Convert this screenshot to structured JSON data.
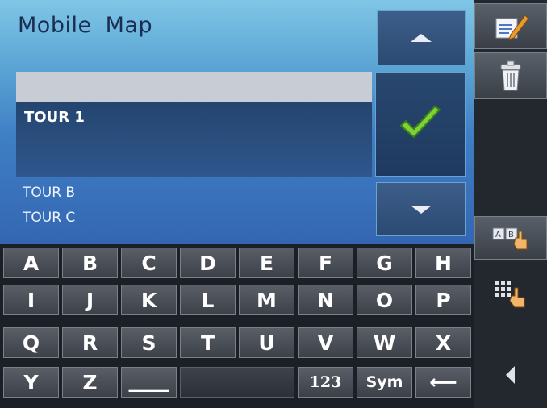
{
  "app": {
    "title": "Mobile Map"
  },
  "search": {
    "value": ""
  },
  "list": {
    "selected": "TOUR 1",
    "items": [
      "TOUR B",
      "TOUR C"
    ]
  },
  "nav": {
    "up_icon": "triangle-up-icon",
    "confirm_icon": "checkmark-icon",
    "down_icon": "triangle-down-icon"
  },
  "keyboard": {
    "rows": [
      [
        "A",
        "B",
        "C",
        "D",
        "E",
        "F",
        "G",
        "H"
      ],
      [
        "I",
        "J",
        "K",
        "L",
        "M",
        "N",
        "O",
        "P"
      ],
      [
        "Q",
        "R",
        "S",
        "T",
        "U",
        "V",
        "W",
        "X"
      ]
    ],
    "bottom": {
      "y": "Y",
      "z": "Z",
      "space": "____",
      "numbers": "123",
      "symbols": "Sym",
      "backspace": "⟵"
    }
  },
  "sidebar": {
    "icons": [
      "edit-icon",
      "trash-icon",
      "abc-keyboard-icon",
      "grid-keypad-icon",
      "back-arrow-icon"
    ]
  },
  "colors": {
    "accent": "#3f7fc4",
    "check": "#6cc530"
  }
}
